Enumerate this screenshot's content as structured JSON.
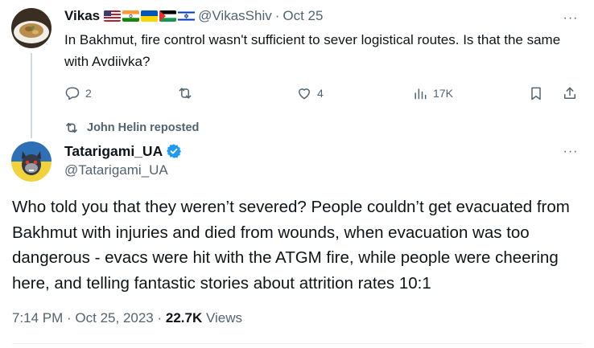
{
  "parent_tweet": {
    "name": "Vikas",
    "flags": [
      "us-flag-icon",
      "india-flag-icon",
      "ukraine-flag-icon",
      "palestine-flag-icon",
      "israel-flag-icon"
    ],
    "handle": "@VikasShiv",
    "separator": "·",
    "time": "Oct 25",
    "text": "In Bakhmut, fire control wasn't sufficient to sever logistical routes. Is that the same with Avdiivka?",
    "more_label": "···",
    "actions": {
      "replies": "2",
      "reposts": "",
      "likes": "4",
      "views": "17K"
    }
  },
  "repost_banner": {
    "text": "John Helin reposted"
  },
  "main_tweet": {
    "name": "Tatarigami_UA",
    "handle": "@Tatarigami_UA",
    "more_label": "···",
    "text": "Who told you that they weren’t severed? People couldn’t get evacuated from Bakhmut with injuries and died from wounds, when evacuation was too dangerous - evacs were hit with the ATGM fire, while people were cheering here, and telling fantastic stories about attrition rates 10:1",
    "timestamp": "7:14 PM · Oct 25, 2023 · ",
    "views_count": "22.7K",
    "views_label": " Views"
  },
  "colors": {
    "text": "#0f1419",
    "secondary": "#536471",
    "verified": "#1d9bf0",
    "line": "#cfd9de"
  }
}
